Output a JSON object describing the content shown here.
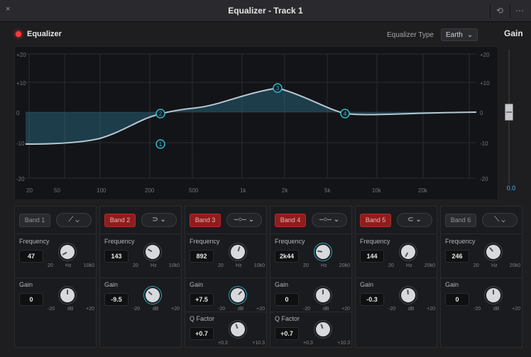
{
  "window": {
    "title": "Equalizer - Track 1",
    "left_icon": "close-icon",
    "right_icons": [
      "reset-icon",
      "more-icon"
    ]
  },
  "header": {
    "equalizer_label": "Equalizer",
    "equalizer_type_label": "Equalizer Type",
    "equalizer_type_value": "Earth",
    "gain_label": "Gain"
  },
  "graph": {
    "y_labels_left": [
      "+20",
      "+10",
      "0",
      "-10",
      "-20"
    ],
    "y_labels_right": [
      "+20",
      "+10",
      "0",
      "-10",
      "-20"
    ],
    "x_labels": [
      "20",
      "50",
      "100",
      "200",
      "500",
      "1k",
      "2k",
      "5k",
      "10k",
      "20k"
    ],
    "markers": [
      "1",
      "2",
      "3",
      "4"
    ]
  },
  "master_gain": {
    "value": "0.0"
  },
  "bands": [
    {
      "name": "Band 1",
      "enabled": false,
      "filter_icon": "high-pass-filter-icon",
      "frequency_label": "Frequency",
      "frequency": "47",
      "freq_scale": [
        "20",
        "Hz",
        "10k0"
      ],
      "gain_label": "Gain",
      "gain": "0",
      "gain_scale": [
        "-20",
        "dB",
        "+20"
      ]
    },
    {
      "name": "Band 2",
      "enabled": true,
      "filter_icon": "low-shelf-filter-icon",
      "frequency_label": "Frequency",
      "frequency": "143",
      "freq_scale": [
        "20",
        "Hz",
        "10k0"
      ],
      "gain_label": "Gain",
      "gain": "-9.5",
      "gain_scale": [
        "-20",
        "dB",
        "+20"
      ]
    },
    {
      "name": "Band 3",
      "enabled": true,
      "filter_icon": "bell-filter-icon",
      "frequency_label": "Frequency",
      "frequency": "892",
      "freq_scale": [
        "20",
        "Hz",
        "10k0"
      ],
      "gain_label": "Gain",
      "gain": "+7.5",
      "gain_scale": [
        "-20",
        "dB",
        "+20"
      ],
      "q_label": "Q Factor",
      "q": "+0.7",
      "q_scale": [
        "+0.3",
        "+10.3"
      ]
    },
    {
      "name": "Band 4",
      "enabled": true,
      "filter_icon": "bell-filter-icon",
      "frequency_label": "Frequency",
      "frequency": "2k44",
      "freq_scale": [
        "20",
        "Hz",
        "20k0"
      ],
      "gain_label": "Gain",
      "gain": "0",
      "gain_scale": [
        "-20",
        "dB",
        "+20"
      ],
      "q_label": "Q Factor",
      "q": "+0.7",
      "q_scale": [
        "+0.3",
        "+10.3"
      ]
    },
    {
      "name": "Band 5",
      "enabled": true,
      "filter_icon": "high-shelf-filter-icon",
      "frequency_label": "Frequency",
      "frequency": "144",
      "freq_scale": [
        "20",
        "Hz",
        "20k0"
      ],
      "gain_label": "Gain",
      "gain": "-0.3",
      "gain_scale": [
        "-20",
        "dB",
        "+20"
      ]
    },
    {
      "name": "Band 6",
      "enabled": false,
      "filter_icon": "low-pass-filter-icon",
      "frequency_label": "Frequency",
      "frequency": "246",
      "freq_scale": [
        "20",
        "Hz",
        "20k0"
      ],
      "gain_label": "Gain",
      "gain": "0",
      "gain_scale": [
        "-20",
        "dB",
        "+20"
      ]
    }
  ]
}
